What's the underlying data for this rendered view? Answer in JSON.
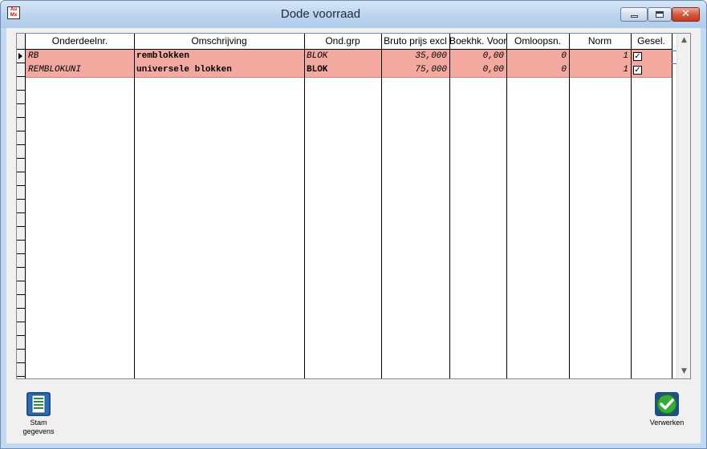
{
  "window": {
    "title": "Dode voorraad",
    "app_icon_text": "Auto\nMax",
    "close_glyph": "✕"
  },
  "grid": {
    "columns": [
      "Onderdeelnr.",
      "Omschrijving",
      "Ond.grp",
      "Bruto prijs excl",
      "Boekhk. Voor",
      "Omloopsn.",
      "Norm",
      "Gesel."
    ],
    "rows": [
      {
        "onderdeelnr": "RB",
        "omschrijving": "remblokken",
        "ond_grp": "BLOK",
        "bruto_prijs": "35,000",
        "boekhk_voor": "0,00",
        "omloopsn": "0",
        "norm": "1",
        "gesel": "✓"
      },
      {
        "onderdeelnr": "REMBLOKUNI",
        "omschrijving": "universele blokken",
        "ond_grp": "BLOK",
        "bruto_prijs": "75,000",
        "boekhk_voor": "0,00",
        "omloopsn": "0",
        "norm": "1",
        "gesel": "✓"
      }
    ],
    "row_highlight_color": "#f4a9a0"
  },
  "scrollbar": {
    "up_glyph": "▲",
    "down_glyph": "▼"
  },
  "toolbar": {
    "stam_label_line1": "Stam",
    "stam_label_line2": "gegevens",
    "verwerken_label": "Verwerken"
  },
  "icons": {
    "stam": "document-list-icon",
    "verwerken": "green-check-icon"
  }
}
